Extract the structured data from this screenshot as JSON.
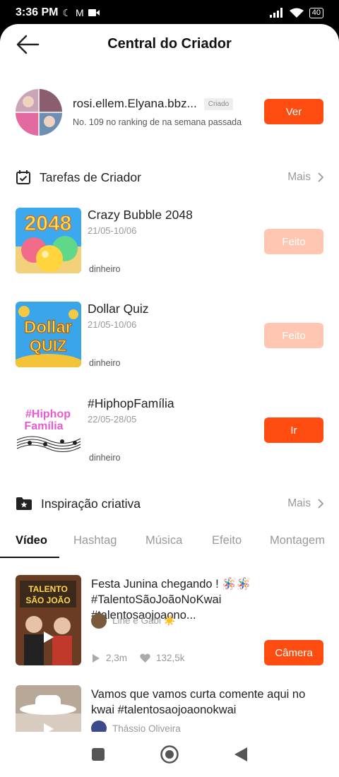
{
  "status_bar": {
    "time": "3:36 PM",
    "battery": "40"
  },
  "header": {
    "title": "Central do Criador"
  },
  "creator": {
    "name": "rosi.ellem.Elyana.bbz...",
    "badge": "Criado",
    "rank": "No. 109 no ranking de na semana passada",
    "button": "Ver"
  },
  "tasks_section": {
    "title": "Tarefas de Criador",
    "more": "Mais",
    "items": [
      {
        "title": "Crazy Bubble 2048",
        "date": "21/05-10/06",
        "reward": "dinheiro",
        "button": "Feito",
        "thumb_text": "2048"
      },
      {
        "title": "Dollar Quiz",
        "date": "21/05-10/06",
        "reward": "dinheiro",
        "button": "Feito",
        "thumb_text_1": "Dollar",
        "thumb_text_2": "QUIZ"
      },
      {
        "title": "#HiphopFamília",
        "date": "22/05-28/05",
        "reward": "dinheiro",
        "button": "Ir",
        "thumb_text_1": "#Hiphop",
        "thumb_text_2": "Família"
      }
    ]
  },
  "inspiration_section": {
    "title": "Inspiração criativa",
    "more": "Mais"
  },
  "tabs": [
    "Vídeo",
    "Hashtag",
    "Música",
    "Efeito",
    "Montagem"
  ],
  "videos": [
    {
      "title": "Festa Junina chegando ! 🪅🪅 #TalentoSãoJoãoNoKwai #talentosaojoaono...",
      "author": "Line e Gabi ☀️",
      "plays": "2,3m",
      "likes": "132,5k",
      "button": "Câmera",
      "thumb_text_1": "TALENTO",
      "thumb_text_2": "SÃO JOÃO"
    },
    {
      "title": "Vamos que vamos curta comente aqui no kwai #talentosaojoaonokwai",
      "author": "Thássio Oliveira"
    }
  ],
  "colors": {
    "accent": "#ff4d12",
    "accent_faded": "#ffc6b1"
  }
}
